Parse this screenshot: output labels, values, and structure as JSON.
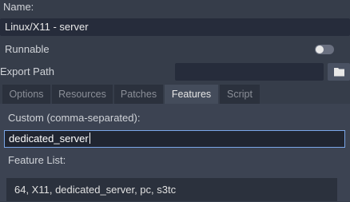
{
  "name": {
    "label": "Name:",
    "value": "Linux/X11 - server"
  },
  "runnable": {
    "label": "Runnable",
    "enabled": false
  },
  "export_path": {
    "label": "Export Path",
    "value": ""
  },
  "tabs": [
    {
      "label": "Options",
      "active": false
    },
    {
      "label": "Resources",
      "active": false
    },
    {
      "label": "Patches",
      "active": false
    },
    {
      "label": "Features",
      "active": true
    },
    {
      "label": "Script",
      "active": false
    }
  ],
  "features": {
    "custom_label": "Custom (comma-separated):",
    "custom_value": "dedicated_server",
    "list_label": "Feature List:",
    "list_value": "64, X11, dedicated_server, pc, s3tc"
  },
  "icons": {
    "browse": "folder-icon"
  },
  "colors": {
    "background": "#363d4a",
    "field": "#262c3b",
    "focus": "#7aa6e8"
  }
}
